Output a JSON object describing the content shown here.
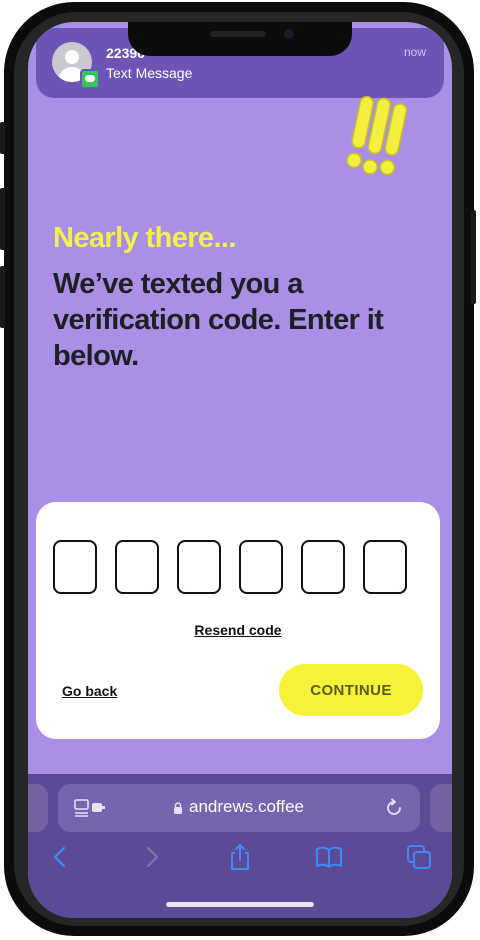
{
  "notification": {
    "sender": "22396",
    "message": "Text Message",
    "time": "now"
  },
  "page": {
    "eyebrow": "Nearly there...",
    "headline": "We’ve texted you a verification code. Enter it below."
  },
  "code_input": {
    "digits": [
      "",
      "",
      "",
      "",
      "",
      ""
    ]
  },
  "actions": {
    "resend": "Resend code",
    "go_back": "Go back",
    "continue": "CONTINUE"
  },
  "browser": {
    "url": "andrews.coffee"
  },
  "colors": {
    "background": "#a98fe6",
    "accent_yellow": "#f6f23a",
    "headline_yellow": "#f2f04c",
    "text_dark": "#1f1f24",
    "card": "#ffffff"
  },
  "icons": {
    "mascot": "exclamation-marks-icon",
    "lock": "lock-icon",
    "reload": "reload-icon",
    "back": "chevron-left-icon",
    "forward": "chevron-right-icon",
    "share": "share-icon",
    "bookmarks": "book-icon",
    "tabs": "tabs-icon"
  }
}
